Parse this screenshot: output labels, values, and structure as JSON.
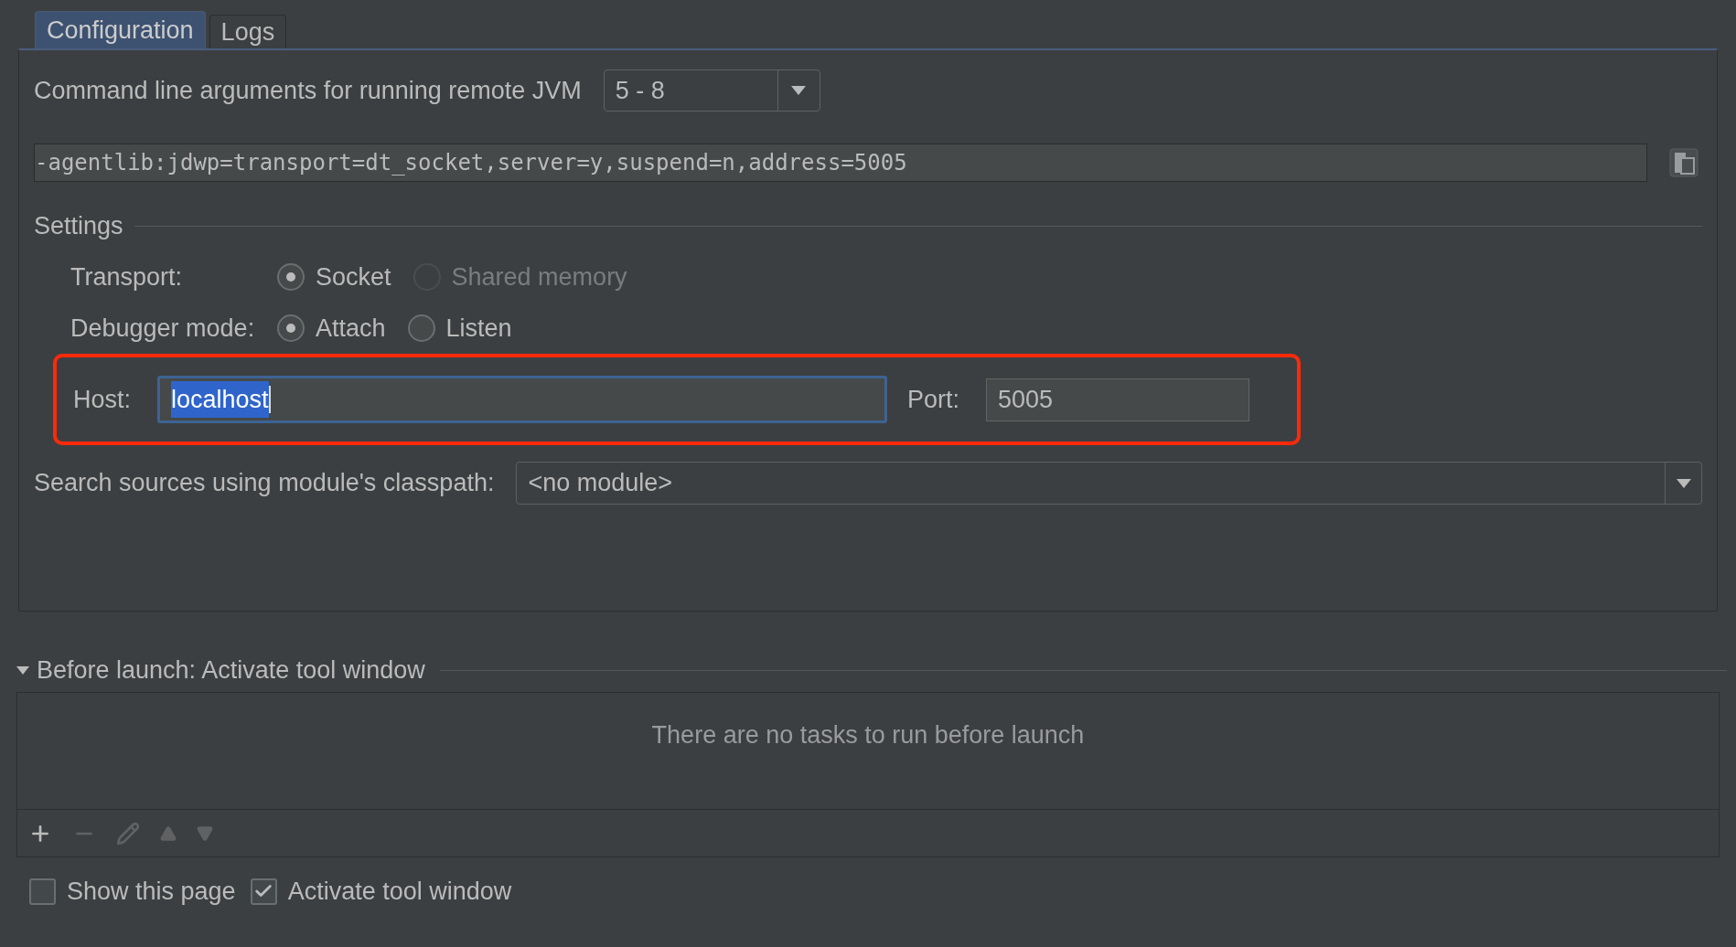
{
  "tabs": [
    {
      "label": "Configuration",
      "selected": true
    },
    {
      "label": "Logs",
      "selected": false
    }
  ],
  "jvm_args": {
    "label": "Command line arguments for running remote JVM",
    "version": "5 - 8"
  },
  "command_line": "-agentlib:jdwp=transport=dt_socket,server=y,suspend=n,address=5005",
  "settings": {
    "title": "Settings",
    "transport": {
      "label": "Transport:",
      "options": [
        {
          "label": "Socket",
          "selected": true,
          "disabled": false
        },
        {
          "label": "Shared memory",
          "selected": false,
          "disabled": true
        }
      ]
    },
    "debugger_mode": {
      "label": "Debugger mode:",
      "options": [
        {
          "label": "Attach",
          "selected": true,
          "disabled": false
        },
        {
          "label": "Listen",
          "selected": false,
          "disabled": false
        }
      ]
    },
    "connection": {
      "highlighted": true,
      "host": {
        "label": "Host:",
        "value": "localhost",
        "text_selected": true
      },
      "port": {
        "label": "Port:",
        "value": "5005"
      }
    }
  },
  "module": {
    "label": "Search sources using module's classpath:",
    "value": "<no module>"
  },
  "before_launch": {
    "title": "Before launch: Activate tool window",
    "expanded": true,
    "empty_text": "There are no tasks to run before launch",
    "toolbar": [
      {
        "kind": "add",
        "disabled": false
      },
      {
        "kind": "remove",
        "disabled": true
      },
      {
        "kind": "edit",
        "disabled": true
      },
      {
        "kind": "up",
        "disabled": true
      },
      {
        "kind": "down",
        "disabled": true
      }
    ]
  },
  "checkboxes": [
    {
      "label": "Show this page",
      "checked": false
    },
    {
      "label": "Activate tool window",
      "checked": true
    }
  ]
}
